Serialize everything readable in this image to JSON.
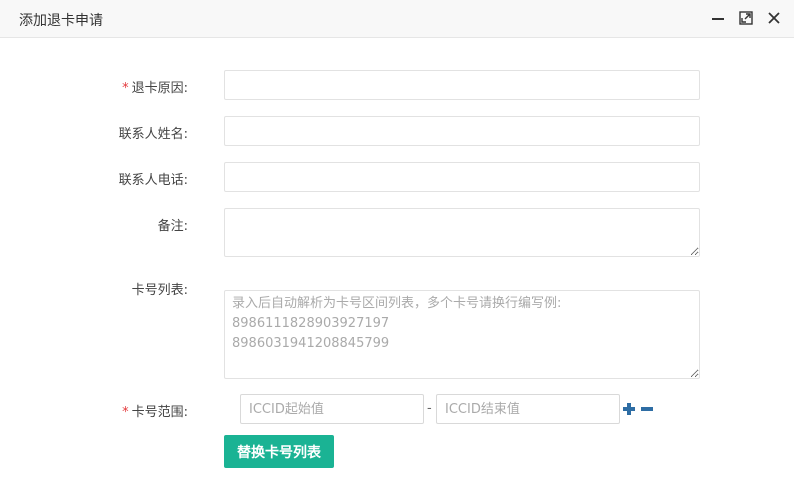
{
  "dialog": {
    "title": "添加退卡申请",
    "controls": [
      "minimize-icon",
      "maximize-icon",
      "close-icon"
    ]
  },
  "form": {
    "reason": {
      "label": "退卡原因:",
      "required": true,
      "value": ""
    },
    "contact_name": {
      "label": "联系人姓名:",
      "required": false,
      "value": ""
    },
    "contact_phone": {
      "label": "联系人电话:",
      "required": false,
      "value": ""
    },
    "remark": {
      "label": "备注:",
      "required": false,
      "value": ""
    },
    "card_list": {
      "label": "卡号列表:",
      "placeholder_line1": "录入后自动解析为卡号区间列表，多个卡号请换行编写例:",
      "placeholder_line2": "8986111828903927197",
      "placeholder_line3": "8986031941208845799"
    },
    "card_range": {
      "label": "卡号范围:",
      "required": true,
      "start_placeholder": "ICCID起始值",
      "separator": "-",
      "end_placeholder": "ICCID结束值"
    },
    "replace_button": "替换卡号列表"
  },
  "colors": {
    "primary": "#1ab394",
    "required_star": "#e4393c",
    "icon_blue": "#2e6da4"
  }
}
